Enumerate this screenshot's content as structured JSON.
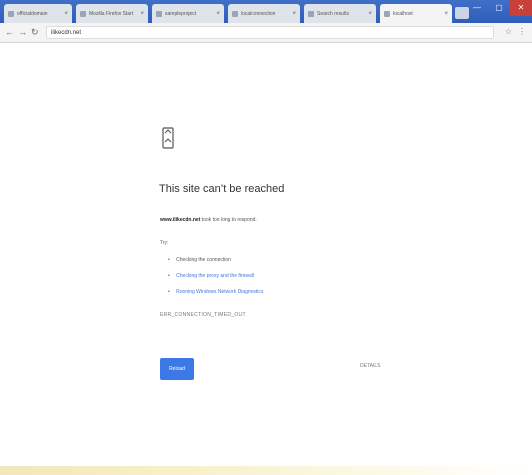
{
  "browser": {
    "tabs": [
      {
        "title": "officialdomain",
        "active": false
      },
      {
        "title": "Mozilla Firefox Start",
        "active": false
      },
      {
        "title": "sampleproject",
        "active": false
      },
      {
        "title": "localconnection",
        "active": false
      },
      {
        "title": "Search results",
        "active": false
      },
      {
        "title": "localhost",
        "active": true
      }
    ],
    "tab_close_glyph": "×",
    "window_controls": [
      "—",
      "▢",
      "✕"
    ],
    "address": "ilikecdn.net",
    "colors": {
      "tab_strip": "#3a68c2",
      "close_button": "#c8403a"
    }
  },
  "error": {
    "title": "This site can’t be reached",
    "domain": "www.ilikecdn.net",
    "description": " took too long to respond.",
    "try_label": "Try:",
    "suggestions": [
      "Checking the connection",
      "Checking the proxy and the firewall",
      "Running Windows Network Diagnostics"
    ],
    "error_code": "ERR_CONNECTION_TIMED_OUT",
    "reload_label": "Reload",
    "details_label": "DETAILS",
    "colors": {
      "accent": "#3c78e6",
      "link": "#4676d6"
    }
  }
}
